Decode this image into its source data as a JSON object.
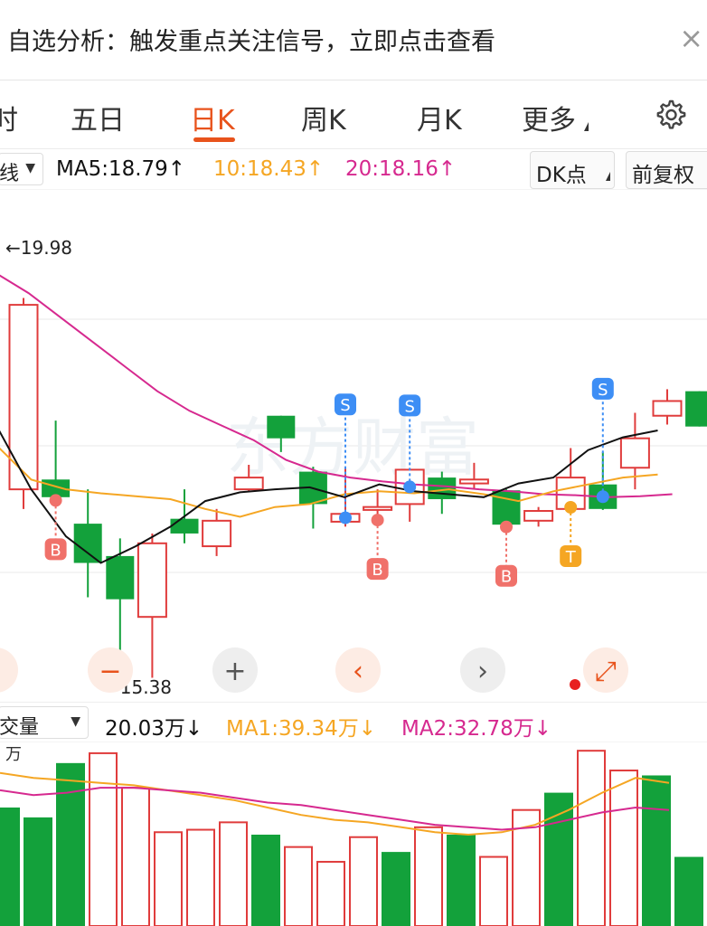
{
  "banner": {
    "text": "自选分析：触发重点关注信号，立即点击查看",
    "close": "×"
  },
  "tabs": [
    {
      "label": "时",
      "active": false
    },
    {
      "label": "五日",
      "active": false
    },
    {
      "label": "日K",
      "active": true
    },
    {
      "label": "周K",
      "active": false
    },
    {
      "label": "月K",
      "active": false
    },
    {
      "label": "更多",
      "active": false
    }
  ],
  "ma_bar": {
    "indicator_select": "线",
    "ma5": "MA5:18.79↑",
    "ma10": "10:18.43↑",
    "ma20": "20:18.16↑",
    "dk_button": "DK点",
    "fq_button": "前复权"
  },
  "colors": {
    "up": "#e03c3c",
    "down": "#13a13b",
    "ma5": "#111111",
    "ma10": "#f5a623",
    "ma20": "#d6298f",
    "accent": "#e8531c",
    "sell": "#3d8ef5",
    "buy": "#f0716a",
    "t": "#f5a623"
  },
  "price_chart": {
    "high_label": "←19.98",
    "low_label": "←15.38",
    "watermark": "东方财富",
    "candles": [
      {
        "dir": "up",
        "open": 17.3,
        "close": 19.18,
        "high": 19.25,
        "low": 17.1
      },
      {
        "dir": "down",
        "open": 17.4,
        "close": 17.22,
        "high": 18.0,
        "low": 17.15
      },
      {
        "dir": "down",
        "open": 16.95,
        "close": 16.55,
        "high": 17.3,
        "low": 16.2
      },
      {
        "dir": "down",
        "open": 16.62,
        "close": 16.18,
        "high": 16.8,
        "low": 15.3
      },
      {
        "dir": "up",
        "open": 16.0,
        "close": 16.75,
        "high": 16.85,
        "low": 15.38
      },
      {
        "dir": "down",
        "open": 17.0,
        "close": 16.85,
        "high": 17.3,
        "low": 16.75
      },
      {
        "dir": "up",
        "open": 16.72,
        "close": 16.98,
        "high": 17.1,
        "low": 16.62
      },
      {
        "dir": "up",
        "open": 17.3,
        "close": 17.42,
        "high": 17.55,
        "low": 17.28
      },
      {
        "dir": "down",
        "open": 18.05,
        "close": 17.82,
        "high": 18.05,
        "low": 17.68
      },
      {
        "dir": "down",
        "open": 17.48,
        "close": 17.15,
        "high": 17.53,
        "low": 16.9
      },
      {
        "dir": "up",
        "open": 16.97,
        "close": 17.05,
        "high": 17.52,
        "low": 16.92
      },
      {
        "dir": "up",
        "open": 17.09,
        "close": 17.12,
        "high": 17.3,
        "low": 16.95
      },
      {
        "dir": "up",
        "open": 17.15,
        "close": 17.5,
        "high": 17.51,
        "low": 16.97
      },
      {
        "dir": "down",
        "open": 17.42,
        "close": 17.2,
        "high": 17.48,
        "low": 17.05
      },
      {
        "dir": "up",
        "open": 17.36,
        "close": 17.4,
        "high": 17.57,
        "low": 17.3
      },
      {
        "dir": "down",
        "open": 17.29,
        "close": 16.94,
        "high": 17.3,
        "low": 16.88
      },
      {
        "dir": "up",
        "open": 16.98,
        "close": 17.08,
        "high": 17.12,
        "low": 16.92
      },
      {
        "dir": "up",
        "open": 17.1,
        "close": 17.42,
        "high": 17.72,
        "low": 17.08
      },
      {
        "dir": "down",
        "open": 17.35,
        "close": 17.1,
        "high": 17.68,
        "low": 17.09
      },
      {
        "dir": "up",
        "open": 17.52,
        "close": 17.82,
        "high": 18.08,
        "low": 17.3
      },
      {
        "dir": "up",
        "open": 18.05,
        "close": 18.2,
        "high": 18.32,
        "low": 17.96
      },
      {
        "dir": "down",
        "open": 18.3,
        "close": 17.94,
        "high": 18.3,
        "low": 17.94
      },
      {
        "dir": "up",
        "open": 17.9,
        "close": 17.92,
        "high": 17.98,
        "low": 17.86
      }
    ],
    "ma5": [
      17.95,
      17.3,
      16.82,
      16.55,
      16.72,
      16.92,
      17.18,
      17.27,
      17.3,
      17.32,
      17.22,
      17.35,
      17.28,
      17.25,
      17.22,
      17.36,
      17.42,
      17.7,
      17.83,
      17.9
    ],
    "ma10": [
      17.75,
      17.4,
      17.3,
      17.26,
      17.23,
      17.2,
      17.1,
      17.02,
      17.12,
      17.15,
      17.25,
      17.28,
      17.26,
      17.3,
      17.25,
      17.18,
      17.28,
      17.35,
      17.42,
      17.45
    ],
    "ma20": [
      19.5,
      19.3,
      19.05,
      18.8,
      18.55,
      18.3,
      18.1,
      17.95,
      17.8,
      17.6,
      17.48,
      17.42,
      17.38,
      17.35,
      17.33,
      17.3,
      17.28,
      17.25,
      17.24,
      17.22,
      17.23,
      17.25
    ],
    "signals": [
      {
        "label": "B",
        "index": 1,
        "type": "buy"
      },
      {
        "label": "S",
        "index": 10,
        "type": "sell"
      },
      {
        "label": "S",
        "index": 12,
        "type": "sell"
      },
      {
        "label": "B",
        "index": 11,
        "type": "buy"
      },
      {
        "label": "B",
        "index": 15,
        "type": "buy"
      },
      {
        "label": "T",
        "index": 17,
        "type": "t"
      },
      {
        "label": "S",
        "index": 18,
        "type": "sell"
      }
    ]
  },
  "controls": [
    {
      "name": "zoom-out",
      "glyph": "−"
    },
    {
      "name": "zoom-in",
      "glyph": "+"
    },
    {
      "name": "prev",
      "glyph": "‹"
    },
    {
      "name": "next",
      "glyph": "›"
    },
    {
      "name": "fullscreen",
      "glyph": "⤢"
    }
  ],
  "vol_bar": {
    "indicator_select": "交量",
    "volume": "20.03万↓",
    "ma1": "MA1:39.34万↓",
    "ma2": "MA2:32.78万↓"
  },
  "vol_chart": {
    "unit": "万",
    "bars": [
      {
        "dir": "down",
        "v": 48
      },
      {
        "dir": "down",
        "v": 44
      },
      {
        "dir": "down",
        "v": 66
      },
      {
        "dir": "up",
        "v": 70
      },
      {
        "dir": "up",
        "v": 56
      },
      {
        "dir": "up",
        "v": 38
      },
      {
        "dir": "up",
        "v": 39
      },
      {
        "dir": "up",
        "v": 42
      },
      {
        "dir": "down",
        "v": 37
      },
      {
        "dir": "up",
        "v": 32
      },
      {
        "dir": "up",
        "v": 26
      },
      {
        "dir": "up",
        "v": 36
      },
      {
        "dir": "down",
        "v": 30
      },
      {
        "dir": "up",
        "v": 40
      },
      {
        "dir": "down",
        "v": 37
      },
      {
        "dir": "up",
        "v": 28
      },
      {
        "dir": "up",
        "v": 47
      },
      {
        "dir": "down",
        "v": 54
      },
      {
        "dir": "up",
        "v": 71
      },
      {
        "dir": "up",
        "v": 63
      },
      {
        "dir": "down",
        "v": 61
      },
      {
        "dir": "down",
        "v": 28
      }
    ],
    "ma1": [
      62,
      60,
      59,
      58,
      57,
      55,
      53,
      51,
      48,
      45,
      43,
      42,
      40,
      38,
      37,
      38,
      41,
      47,
      54,
      60,
      58
    ],
    "ma2": [
      55,
      53,
      54,
      56,
      56,
      55,
      54,
      52,
      50,
      49,
      47,
      45,
      43,
      41,
      40,
      39,
      40,
      43,
      46,
      48,
      47
    ]
  }
}
